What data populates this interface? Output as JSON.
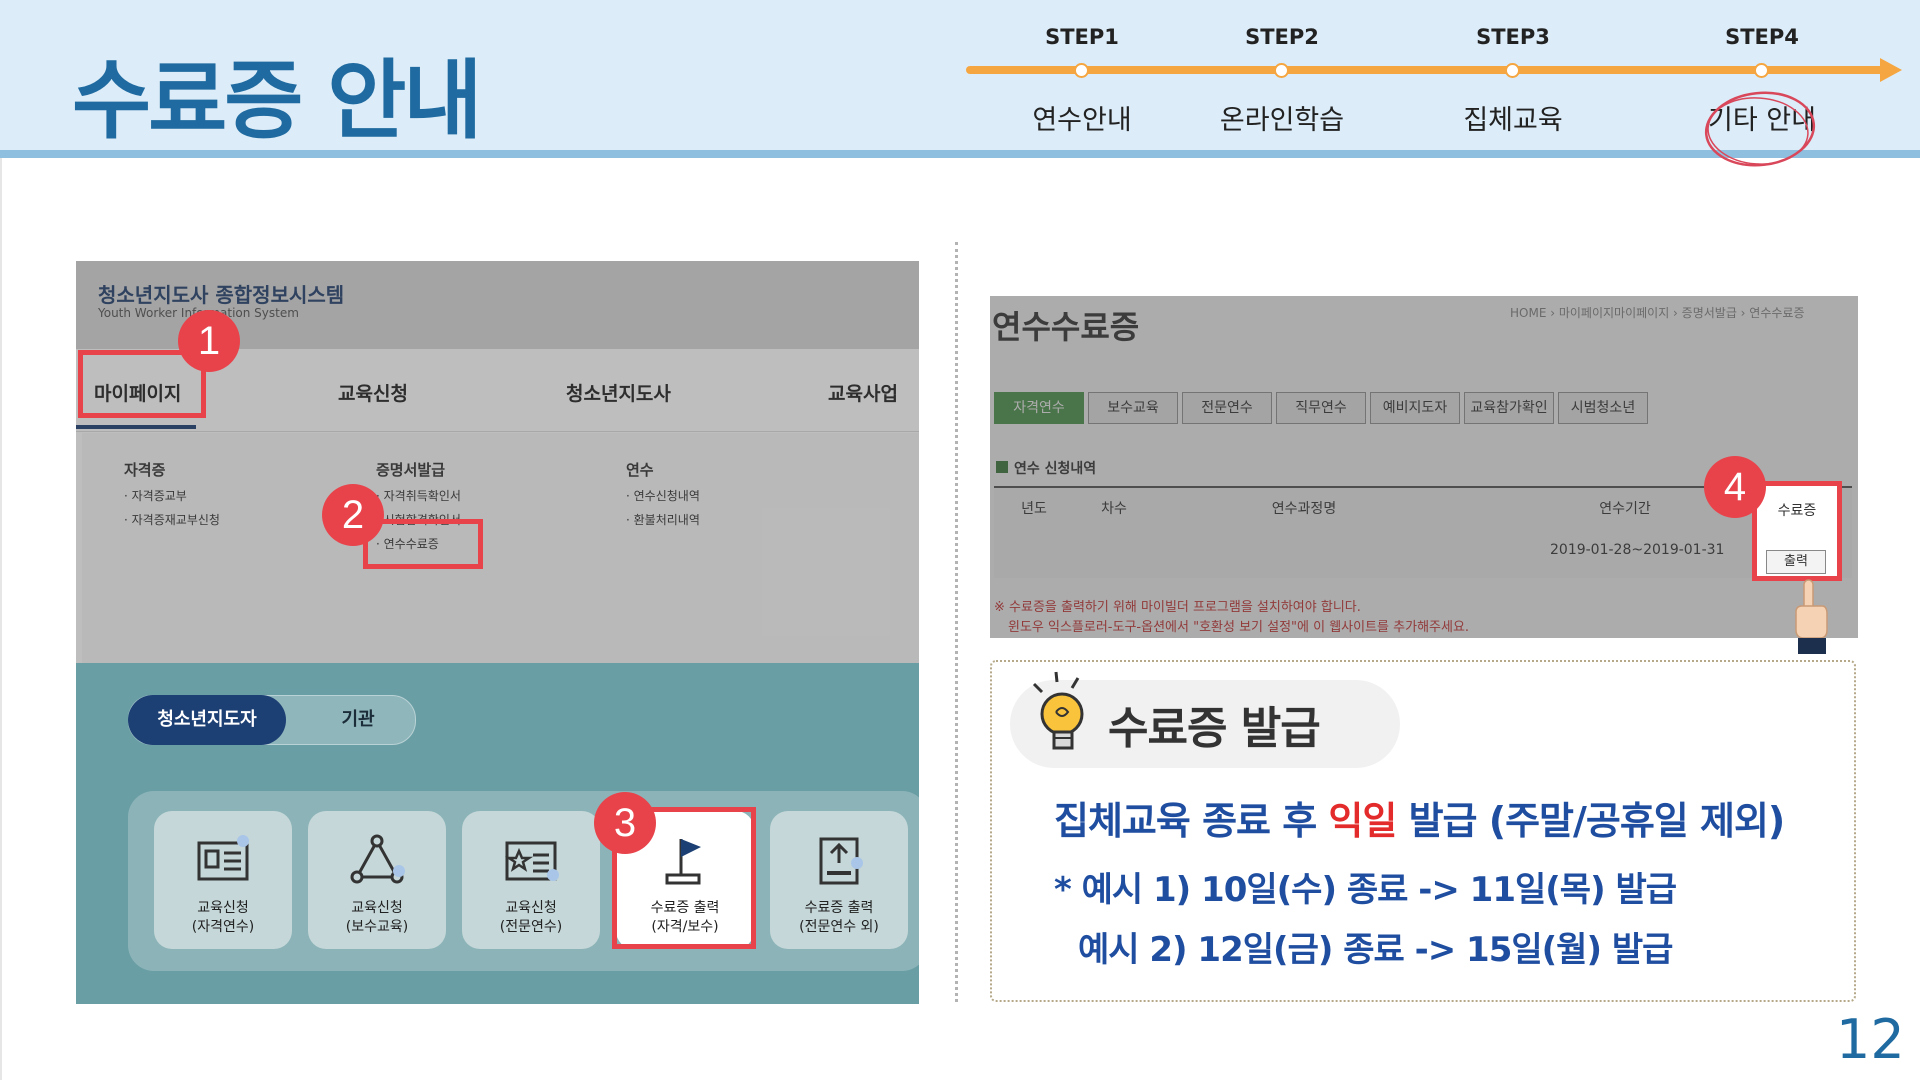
{
  "title": "수료증 안내",
  "steps": [
    {
      "label": "STEP1",
      "name": "연수안내"
    },
    {
      "label": "STEP2",
      "name": "온라인학습"
    },
    {
      "label": "STEP3",
      "name": "집체교육"
    },
    {
      "label": "STEP4",
      "name": "기타 안내"
    }
  ],
  "left_shot": {
    "logo": "청소년지도사 종합정보시스템",
    "logo_sub": "Youth Worker Information System",
    "nav": [
      "마이페이지",
      "교육신청",
      "청소년지도사",
      "교육사업"
    ],
    "dropdown": {
      "col1": {
        "head": "자격증",
        "items": [
          "· 자격증교부",
          "· 자격증재교부신청"
        ]
      },
      "col2": {
        "head": "증명서발급",
        "items": [
          "· 자격취득확인서",
          "· 시험합격확인서",
          "· 연수수료증"
        ]
      },
      "col3": {
        "head": "연수",
        "items": [
          "· 연수신청내역",
          "· 환불처리내역"
        ]
      }
    },
    "toggle": {
      "on": "청소년지도자",
      "off": "기관"
    },
    "cards": [
      {
        "line1": "교육신청",
        "line2": "(자격연수)",
        "icon": "document-card-icon"
      },
      {
        "line1": "교육신청",
        "line2": "(보수교육)",
        "icon": "network-triangle-icon"
      },
      {
        "line1": "교육신청",
        "line2": "(전문연수)",
        "icon": "id-card-star-icon"
      },
      {
        "line1": "수료증 출력",
        "line2": "(자격/보수)",
        "icon": "flag-icon"
      },
      {
        "line1": "수료증 출력",
        "line2": "(전문연수 외)",
        "icon": "upload-box-icon"
      }
    ]
  },
  "badges": [
    "1",
    "2",
    "3",
    "4"
  ],
  "right_shot": {
    "title": "연수수료증",
    "breadcrumb": "HOME › 마이페이지마이페이지 › 증명서발급 › 연수수료증",
    "tabs": [
      "자격연수",
      "보수교육",
      "전문연수",
      "직무연수",
      "예비지도자",
      "교육참가확인",
      "시범청소년"
    ],
    "subtitle": "연수 신청내역",
    "headers": [
      "년도",
      "차수",
      "연수과정명",
      "연수기간",
      "수료증"
    ],
    "row": {
      "period": "2019-01-28~2019-01-31",
      "action": "출력"
    },
    "notes": [
      "※ 수료증을 출력하기 위해 마이빌더 프로그램을 설치하여야 합니다.",
      "윈도우 익스플로러-도구-옵션에서 \"호환성 보기 설정\"에 이 웹사이트를 추가해주세요."
    ]
  },
  "info": {
    "title": "수료증 발급",
    "main_before": "집체교육 종료 후 ",
    "main_highlight": "익일",
    "main_after": " 발급 (주말/공휴일 제외)",
    "example1": "* 예시 1) 10일(수) 종료 -> 11일(목) 발급",
    "example2": "예시 2) 12일(금) 종료 -> 15일(월) 발급"
  },
  "page_number": "12",
  "colors": {
    "accent": "#1f6aa0",
    "red": "#e8434b",
    "orange": "#f6a640",
    "blue_text": "#1f4ea1"
  }
}
